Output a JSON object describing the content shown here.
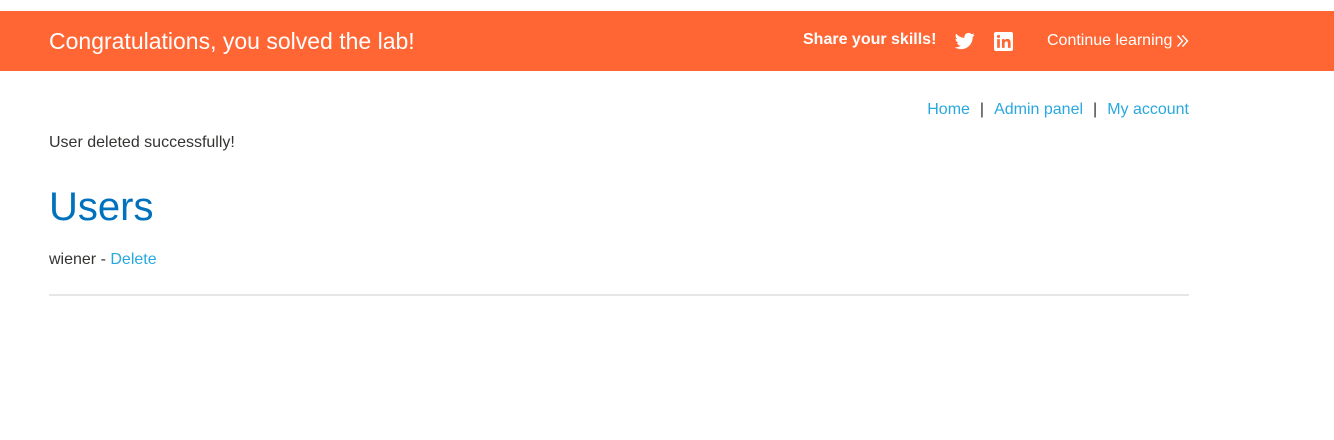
{
  "banner": {
    "title": "Congratulations, you solved the lab!",
    "share_label": "Share your skills!",
    "twitter_icon": "twitter-icon",
    "linkedin_icon": "linkedin-icon",
    "continue_label": "Continue learning",
    "continue_icon": "double-chevron-right-icon",
    "background_color": "#ff6633"
  },
  "nav": {
    "items": [
      {
        "label": "Home"
      },
      {
        "label": "Admin panel"
      },
      {
        "label": "My account"
      }
    ],
    "separator": "|",
    "link_color": "#29a8e0"
  },
  "main": {
    "message": "User deleted successfully!",
    "heading": "Users",
    "heading_color": "#0071bc",
    "users": [
      {
        "name": "wiener",
        "separator": " - ",
        "action_label": "Delete"
      }
    ]
  }
}
